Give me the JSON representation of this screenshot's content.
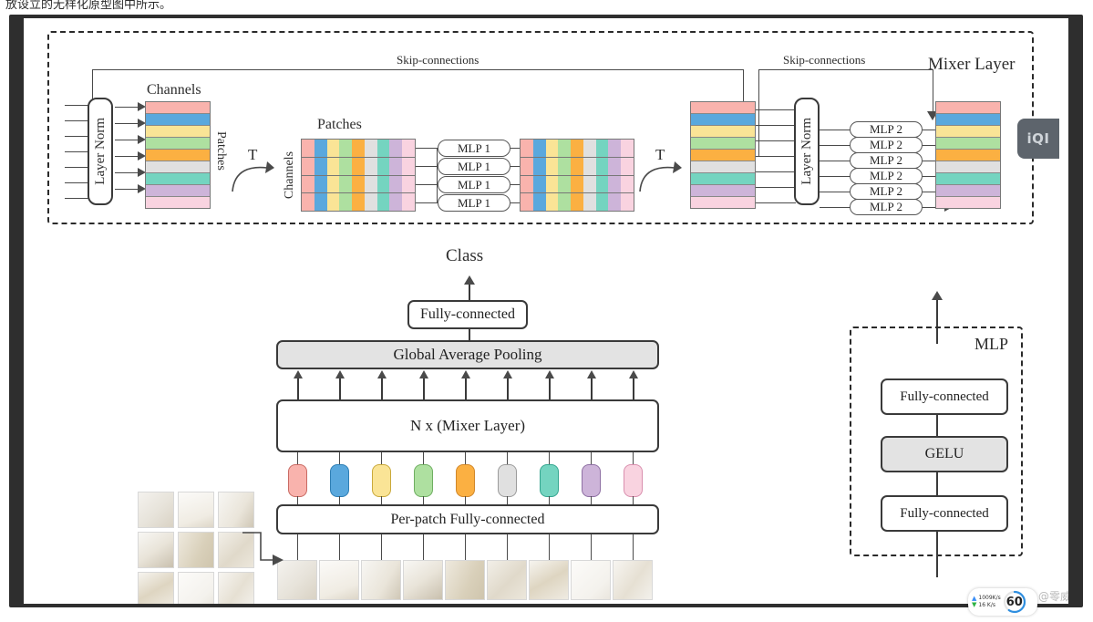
{
  "page": {
    "top_note": "放设立的无样化原型图中所示。"
  },
  "mixer_layer": {
    "title": "Mixer Layer",
    "skip_left": "Skip-connections",
    "skip_right": "Skip-connections",
    "layer_norm_1": "Layer Norm",
    "layer_norm_2": "Layer Norm",
    "channels_label_1": "Channels",
    "patches_label_side": "Patches",
    "transpose_1": "T",
    "channels_label_side": "Channels",
    "patches_label_top": "Patches",
    "transpose_2": "T",
    "mlp1_label": "MLP 1",
    "mlp1_count": 4,
    "mlp2_label": "MLP 2",
    "mlp2_count": 6
  },
  "palette": {
    "stripes": [
      "#f9b3ad",
      "#5aa8dd",
      "#fae496",
      "#aee0a0",
      "#fbb042",
      "#e0e0e0",
      "#74d4c0",
      "#cdb4d9",
      "#f9d3e0"
    ],
    "token_borders": [
      "#c96a63",
      "#2f7fb5",
      "#c9a93b",
      "#6fae61",
      "#d1872a",
      "#9b9b9b",
      "#35a690",
      "#8e6fa3",
      "#d98fae"
    ]
  },
  "pipeline": {
    "class_label": "Class",
    "fully_connected_top": "Fully-connected",
    "global_average_pooling": "Global Average Pooling",
    "mixer_stack": "N x (Mixer Layer)",
    "per_patch_fc": "Per-patch Fully-connected",
    "token_count": 9,
    "patch_count": 9,
    "gap_arrow_count": 9,
    "thumbnail_grid": "3x3"
  },
  "mlp_detail": {
    "title": "MLP",
    "fc_top": "Fully-connected",
    "gelu": "GELU",
    "fc_bottom": "Fully-connected"
  },
  "overlays": {
    "side_tab": "iQI",
    "net_upload": "1009K/s",
    "net_download": "16 K/s",
    "gauge_value": "60",
    "watermark": "CSDN @零威"
  }
}
